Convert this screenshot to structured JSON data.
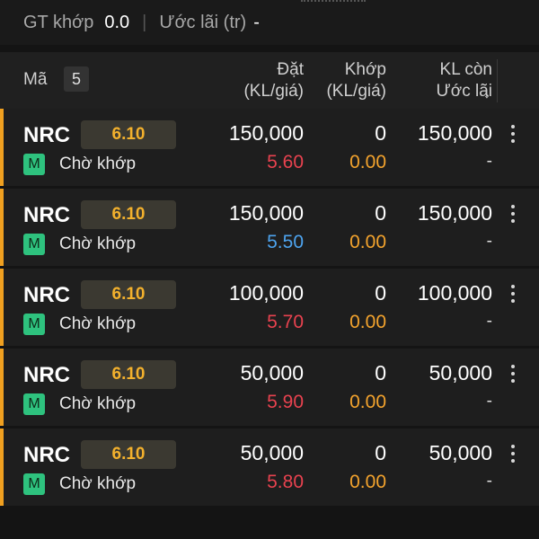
{
  "summary": {
    "gt_label": "GT khớp",
    "gt_value": "0.0",
    "profit_label": "Ước lãi (tr)",
    "profit_value": "-"
  },
  "header": {
    "symbol_label": "Mã",
    "count": "5",
    "order_line1": "Đặt",
    "order_line2": "(KL/giá)",
    "match_line1": "Khớp",
    "match_line2": "(KL/giá)",
    "remain_line1": "KL còn",
    "remain_line2": "Ước lãi",
    "sort_icon": "arrow-down-icon"
  },
  "colors": {
    "accent_orange": "#f0a020",
    "price_red": "#e8424f",
    "price_blue": "#4da3ee",
    "match_orange": "#f3a32d",
    "badge_green": "#2ec27e"
  },
  "orders": [
    {
      "symbol": "NRC",
      "ref_price": "6.10",
      "market_badge": "M",
      "status": "Chờ khớp",
      "order_volume": "150,000",
      "order_price": "5.60",
      "order_price_color": "#e8424f",
      "matched_volume": "0",
      "matched_price": "0.00",
      "remaining_volume": "150,000",
      "est_profit": "-"
    },
    {
      "symbol": "NRC",
      "ref_price": "6.10",
      "market_badge": "M",
      "status": "Chờ khớp",
      "order_volume": "150,000",
      "order_price": "5.50",
      "order_price_color": "#4da3ee",
      "matched_volume": "0",
      "matched_price": "0.00",
      "remaining_volume": "150,000",
      "est_profit": "-"
    },
    {
      "symbol": "NRC",
      "ref_price": "6.10",
      "market_badge": "M",
      "status": "Chờ khớp",
      "order_volume": "100,000",
      "order_price": "5.70",
      "order_price_color": "#e8424f",
      "matched_volume": "0",
      "matched_price": "0.00",
      "remaining_volume": "100,000",
      "est_profit": "-"
    },
    {
      "symbol": "NRC",
      "ref_price": "6.10",
      "market_badge": "M",
      "status": "Chờ khớp",
      "order_volume": "50,000",
      "order_price": "5.90",
      "order_price_color": "#e8424f",
      "matched_volume": "0",
      "matched_price": "0.00",
      "remaining_volume": "50,000",
      "est_profit": "-"
    },
    {
      "symbol": "NRC",
      "ref_price": "6.10",
      "market_badge": "M",
      "status": "Chờ khớp",
      "order_volume": "50,000",
      "order_price": "5.80",
      "order_price_color": "#e8424f",
      "matched_volume": "0",
      "matched_price": "0.00",
      "remaining_volume": "50,000",
      "est_profit": "-"
    }
  ]
}
